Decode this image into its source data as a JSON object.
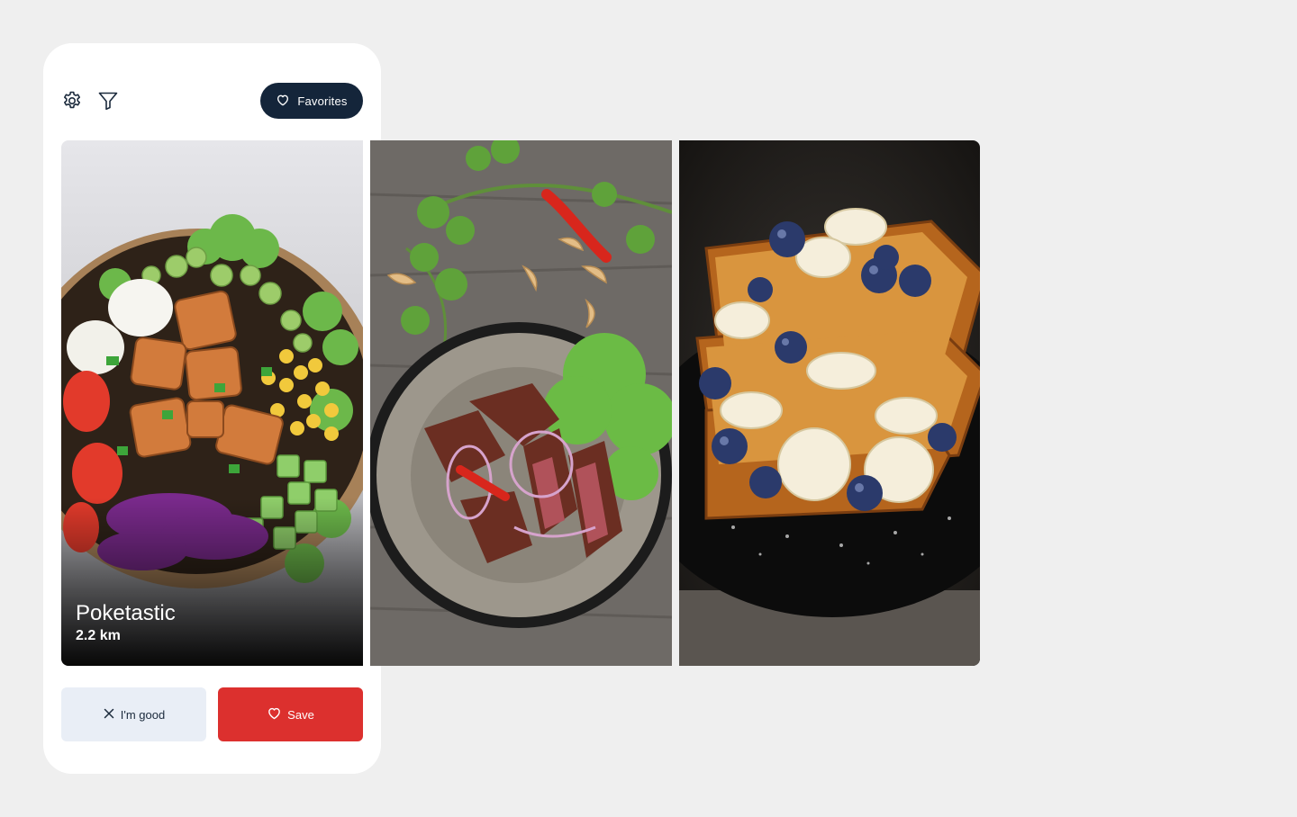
{
  "toolbar": {
    "settings_icon": "gear-icon",
    "filter_icon": "filter-icon",
    "favorites_label": "Favorites",
    "favorites_icon": "heart-icon"
  },
  "cards": [
    {
      "name": "Poketastic",
      "distance": "2.2 km",
      "image": "poke-bowl-photo"
    },
    {
      "image": "steak-plate-photo"
    },
    {
      "image": "french-toast-photo"
    }
  ],
  "actions": {
    "pass_label": "I'm good",
    "pass_icon": "close-icon",
    "save_label": "Save",
    "save_icon": "heart-icon"
  },
  "colors": {
    "background": "#efefef",
    "favorites_button": "#14253a",
    "pass_button": "#e9eef6",
    "save_button": "#dc302e"
  }
}
